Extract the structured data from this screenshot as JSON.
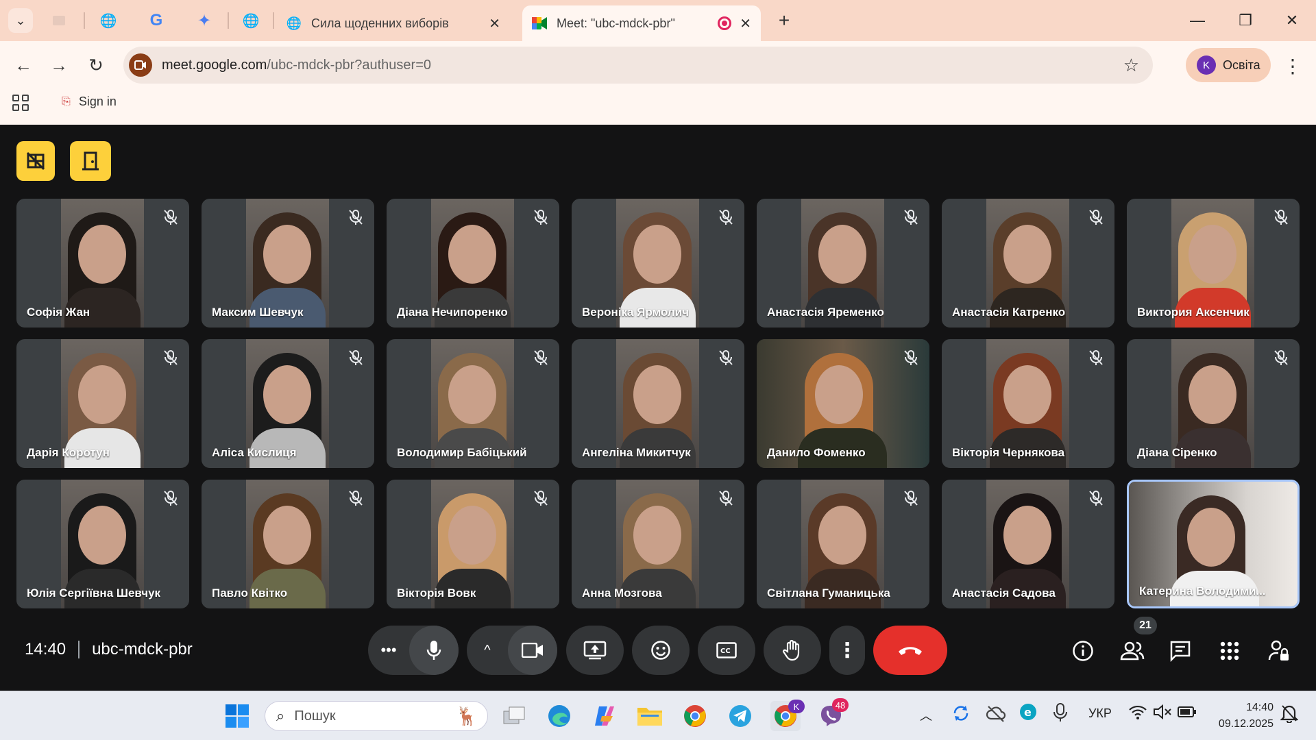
{
  "browser": {
    "tabs": [
      {
        "title": "Сила щоденних виборів",
        "active": false
      },
      {
        "title": "Meet: \"ubc-mdck-pbr\"",
        "active": true
      }
    ],
    "url_host": "meet.google.com",
    "url_path": "/ubc-mdck-pbr?authuser=0",
    "profile_name": "Освіта",
    "profile_initial": "K",
    "bookmark_signin": "Sign in"
  },
  "meeting": {
    "time": "14:40",
    "code": "ubc-mdck-pbr",
    "participant_count": "21",
    "participants": [
      "Софія Жан",
      "Максим Шевчук",
      "Діана Нечипоренко",
      "Вероніка Ярмолич",
      "Анастасія Яременко",
      "Анастасія Катренко",
      "Виктория Аксенчик",
      "Дарія Коротун",
      "Аліса Кислиця",
      "Володимир Бабіцький",
      "Ангеліна Микитчук",
      "Данило Фоменко",
      "Вікторія Чернякова",
      "Діана Сіренко",
      "Юлія Сергіївна Шевчук",
      "Павло Квітко",
      "Вікторія Вовк",
      "Анна Мозгова",
      "Світлана Гуманицька",
      "Анастасія Садова",
      "Катерина Володими..."
    ]
  },
  "taskbar": {
    "search_placeholder": "Пошук",
    "viber_badge": "48",
    "chrome_profile_badge": "K",
    "language": "УКР",
    "clock_time": "14:40",
    "clock_date": "09.12.2025"
  },
  "colors": {
    "meet_bg": "#131314",
    "tile_bg": "#3c4043",
    "end_call": "#e5302b",
    "yellow_button": "#fdd03b",
    "tab_bar": "#f9d8c8"
  }
}
